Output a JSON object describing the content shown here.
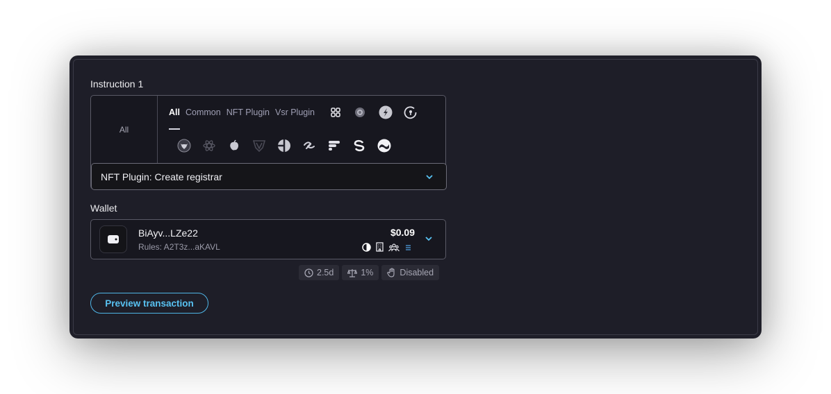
{
  "instruction": {
    "label": "Instruction 1",
    "all_label": "All",
    "tabs": [
      "All",
      "Common",
      "NFT Plugin",
      "Vsr Plugin"
    ],
    "selected_instruction": "NFT Plugin: Create registrar",
    "icons_row1": [
      "grid-knot-icon",
      "gear-globe-icon",
      "bolt-circle-icon",
      "lock-circle-icon"
    ],
    "icons_row2": [
      "bull-circle-icon",
      "atom-icon",
      "apple-drop-icon",
      "shield-icon",
      "split-circle-icon",
      "squiggle-icon",
      "bars-icon",
      "swirl-icon",
      "wave-circle-icon"
    ]
  },
  "wallet": {
    "label": "Wallet",
    "name": "BiAyv...LZe22",
    "rules": "Rules: A2T3z...aKAVL",
    "balance": "$0.09",
    "badges": [
      "half-circle-icon",
      "building-icon",
      "people-icon",
      "list-icon"
    ]
  },
  "chips": {
    "time": "2.5d",
    "quorum": "1%",
    "veto": "Disabled"
  },
  "actions": {
    "preview": "Preview transaction"
  },
  "colors": {
    "accent": "#58c2f2",
    "panel": "#1f1f29"
  }
}
